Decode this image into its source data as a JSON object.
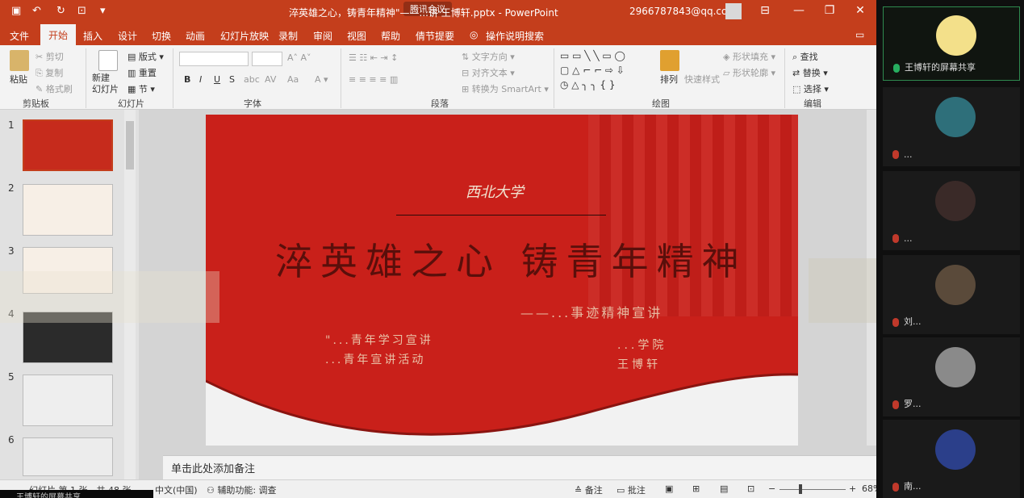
{
  "window": {
    "title": "淬英雄之心，铸青年精神\"——...讲 王博轩.pptx - PowerPoint",
    "meeting_tag": "腾讯会议",
    "account": "2966787843@qq.com",
    "minimize": "—",
    "restore": "❐",
    "close": "✕"
  },
  "tabs": [
    "文件",
    "开始",
    "插入",
    "设计",
    "切换",
    "动画",
    "幻灯片放映",
    "录制",
    "审阅",
    "视图",
    "帮助",
    "倩节提要",
    "操作说明搜索"
  ],
  "ribbon": {
    "paste": "粘贴",
    "cut": "剪切",
    "copy": "复制",
    "format_painter": "格式刷",
    "new_slide": "新建\n幻灯片",
    "layout": "版式",
    "reset": "重置",
    "section": "节",
    "text_direction": "文字方向",
    "align_text": "对齐文本",
    "smartart": "转换为 SmartArt",
    "arrange": "排列",
    "quick_styles": "快速样式",
    "shape_fill": "形状填充",
    "shape_outline": "形状轮廓",
    "find": "查找",
    "replace": "替换",
    "select": "选择",
    "groups": [
      "剪贴板",
      "幻灯片",
      "字体",
      "段落",
      "绘图",
      "编辑"
    ]
  },
  "thumbnails": [
    "1",
    "2",
    "3",
    "4",
    "5",
    "6"
  ],
  "slide": {
    "university": "西北大学",
    "title": "淬英雄之心 铸青年精神",
    "subtitle": "——...事迹精神宣讲",
    "left_line1": "\"...青年学习宣讲",
    "left_line2": "...青年宣讲活动",
    "right_line1": "...学院",
    "right_line2": "王博轩"
  },
  "notes_placeholder": "单击此处添加备注",
  "status": {
    "slide_counter": "幻灯片 第 1 张，共 48 张",
    "language": "中文(中国)",
    "accessibility": "辅助功能: 调查",
    "notes": "备注",
    "comments": "批注",
    "zoom": "68%"
  },
  "participants": {
    "sharer": "王博轩的屏幕共享",
    "list": [
      "...",
      "...",
      "刘...",
      "罗...",
      "南..."
    ]
  },
  "share_bar": "王博轩的屏幕共享"
}
